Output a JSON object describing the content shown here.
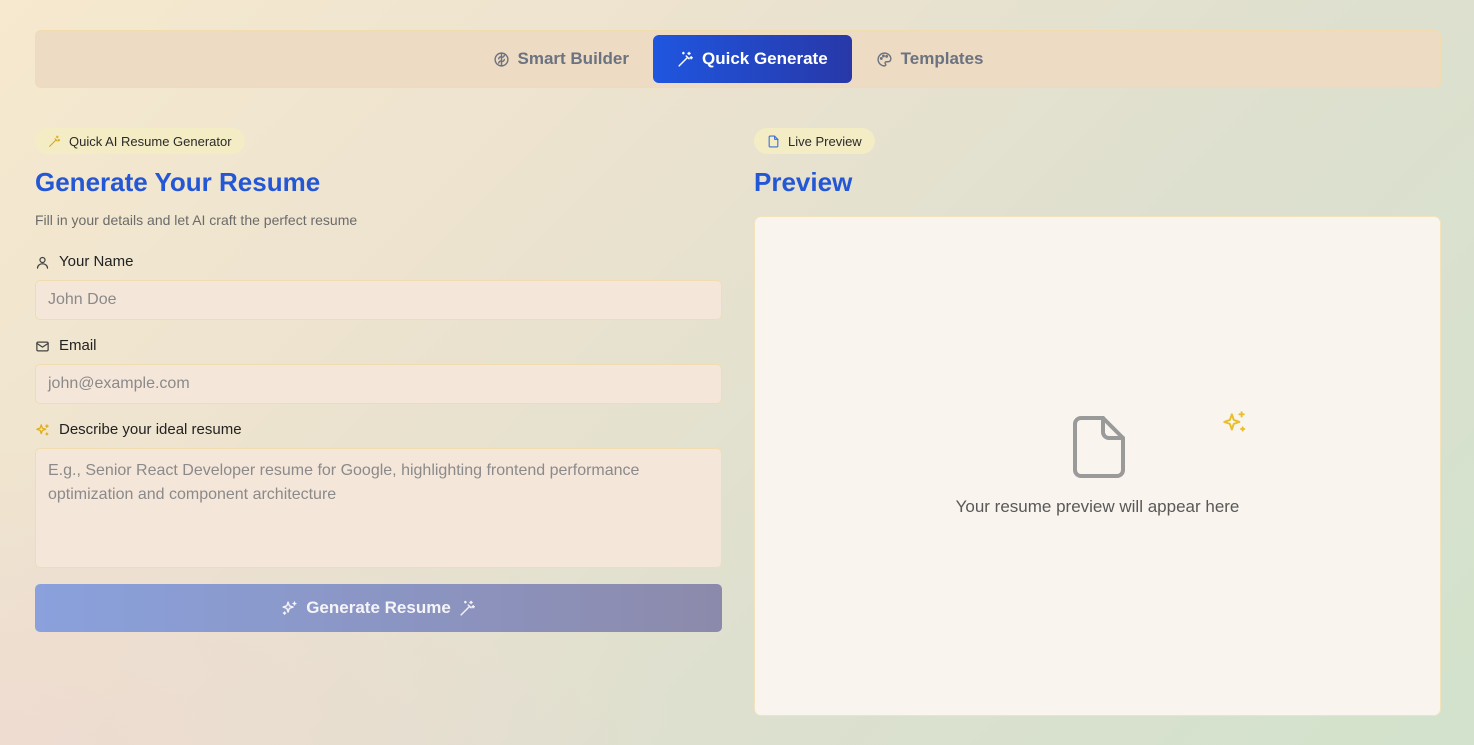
{
  "tabs": [
    {
      "label": "Smart Builder",
      "icon": "brain-icon",
      "active": false
    },
    {
      "label": "Quick Generate",
      "icon": "magic-wand-icon",
      "active": true
    },
    {
      "label": "Templates",
      "icon": "palette-icon",
      "active": false
    }
  ],
  "left": {
    "badge": "Quick AI Resume Generator",
    "title": "Generate Your Resume",
    "subtitle": "Fill in your details and let AI craft the perfect resume",
    "name_label": "Your Name",
    "name_placeholder": "John Doe",
    "email_label": "Email",
    "email_placeholder": "john@example.com",
    "describe_label": "Describe your ideal resume",
    "describe_placeholder": "E.g., Senior React Developer resume for Google, highlighting frontend performance optimization and component architecture",
    "generate_button": "Generate Resume"
  },
  "right": {
    "badge": "Live Preview",
    "title": "Preview",
    "empty_message": "Your resume preview will appear here"
  },
  "colors": {
    "accent": "#2457d6",
    "active_tab_start": "#1f56e0",
    "active_tab_end": "#2838a8",
    "sparkle": "#e8bf2a"
  }
}
